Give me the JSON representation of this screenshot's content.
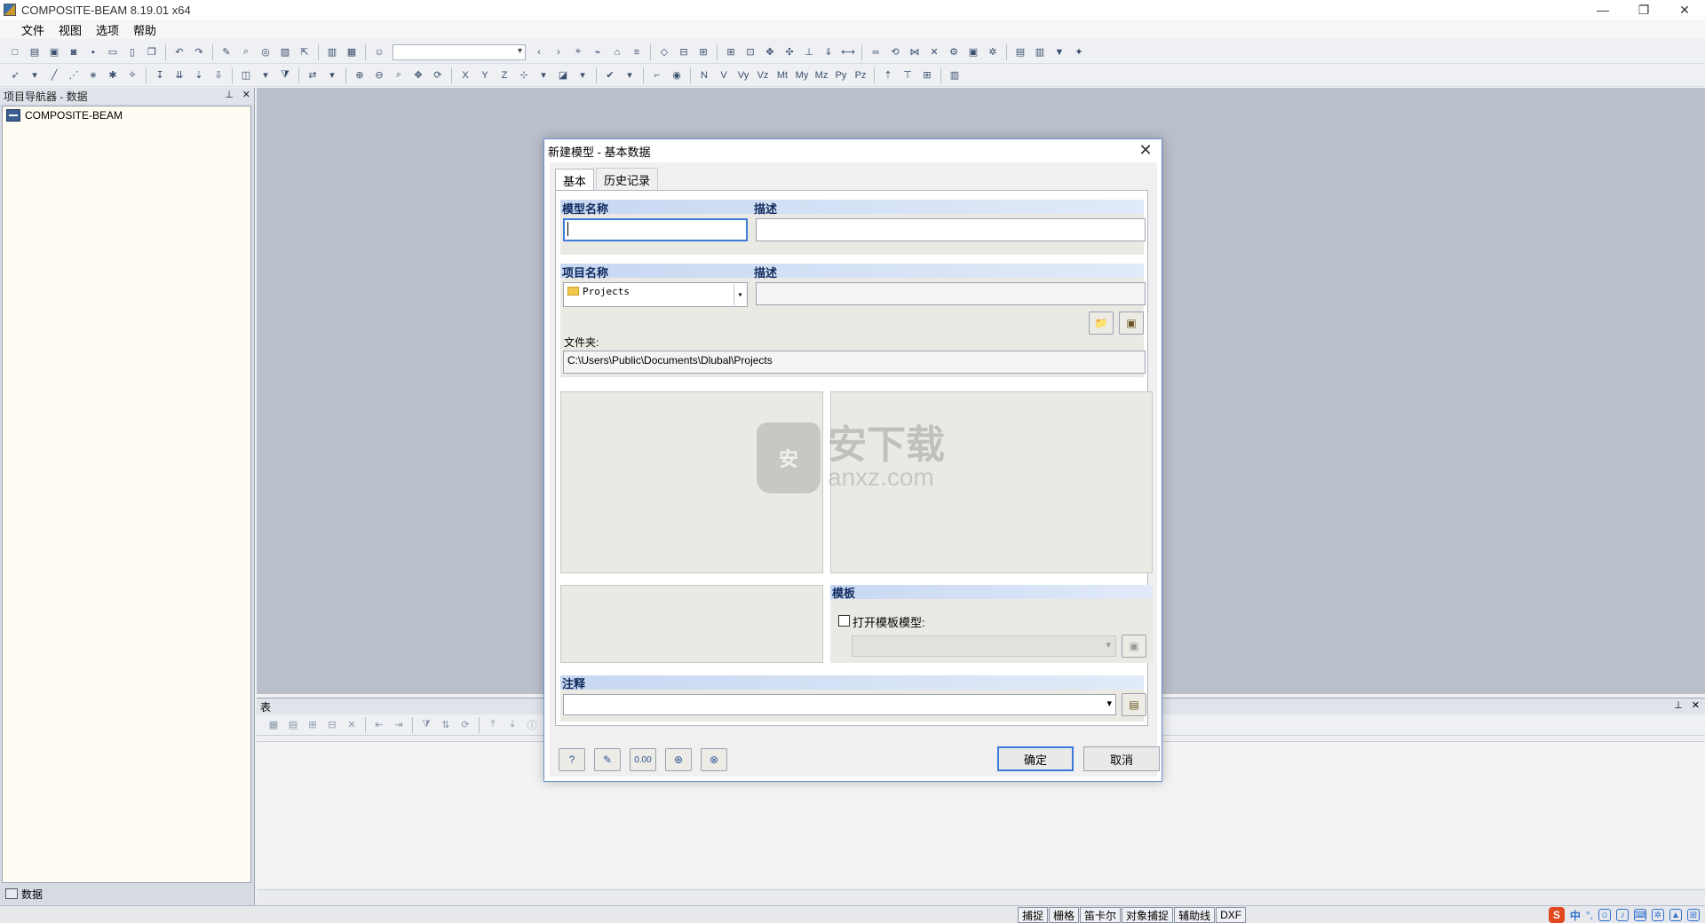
{
  "window": {
    "title": "COMPOSITE-BEAM 8.19.01 x64",
    "controls": [
      "—",
      "❐",
      "✕"
    ]
  },
  "menubar": {
    "items": [
      "文件",
      "视图",
      "选项",
      "帮助"
    ]
  },
  "navigator": {
    "header": "项目导航器 - 数据",
    "pin_icon": "pin-icon",
    "close_icon": "close-icon",
    "tree_root": "COMPOSITE-BEAM",
    "footer_tab": "数据"
  },
  "table_panel": {
    "header": "表"
  },
  "statusbar": {
    "toggles": [
      "捕捉",
      "栅格",
      "笛卡尔",
      "对象捕捉",
      "辅助线",
      "DXF"
    ],
    "ime": {
      "logo": "S",
      "lang": "中",
      "punct": "°,"
    }
  },
  "dialog": {
    "title": "新建模型 - 基本数据",
    "tabs": [
      "基本",
      "历史记录"
    ],
    "active_tab": "基本",
    "model_name_label": "模型名称",
    "model_desc_label": "描述",
    "model_name_value": "",
    "model_desc_value": "",
    "project_name_label": "项目名称",
    "project_desc_label": "描述",
    "project_name_value": "Projects",
    "project_desc_value": "",
    "folder_label": "文件夹:",
    "folder_value": "C:\\Users\\Public\\Documents\\Dlubal\\Projects",
    "template_label": "模板",
    "template_checkbox_label": "打开模板模型:",
    "template_checked": false,
    "notes_label": "注释",
    "notes_value": "",
    "ok_label": "确定",
    "cancel_label": "取消",
    "watermark_cn": "安下载",
    "watermark_en": "anxz.com",
    "watermark_bag": "安"
  },
  "colors": {
    "workspace": "#b9bfcb",
    "group_header": "#c8d8f2",
    "focus": "#3d7bd8"
  }
}
